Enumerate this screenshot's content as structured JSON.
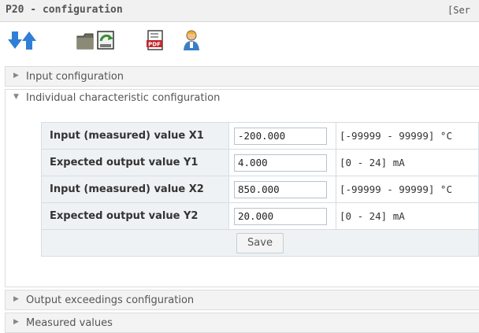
{
  "window": {
    "title": "P20 - configuration",
    "right_text": "[Ser"
  },
  "toolbar": {
    "icons": [
      "arrow-down-icon",
      "arrow-up-icon",
      "folder-icon",
      "save-file-icon",
      "pdf-icon",
      "user-icon"
    ]
  },
  "sections": {
    "input_config": {
      "label": "Input configuration",
      "expanded": false
    },
    "individual": {
      "label": "Individual characteristic configuration",
      "expanded": true
    },
    "output_exceed": {
      "label": "Output exceedings configuration",
      "expanded": false
    },
    "measured": {
      "label": "Measured values",
      "expanded": false
    }
  },
  "table": {
    "rows": [
      {
        "label": "Input (measured) value X1",
        "value": "-200.000",
        "range": "[-99999 - 99999] °C"
      },
      {
        "label": "Expected output value Y1",
        "value": "4.000",
        "range": "[0 - 24] mA"
      },
      {
        "label": "Input (measured) value X2",
        "value": "850.000",
        "range": "[-99999 - 99999] °C"
      },
      {
        "label": "Expected output value Y2",
        "value": "20.000",
        "range": "[0 - 24] mA"
      }
    ],
    "save_label": "Save"
  },
  "colors": {
    "arrow_blue": "#2f7fd6",
    "title_bg": "#f1f1f1",
    "label_bg": "#eef2f5"
  }
}
